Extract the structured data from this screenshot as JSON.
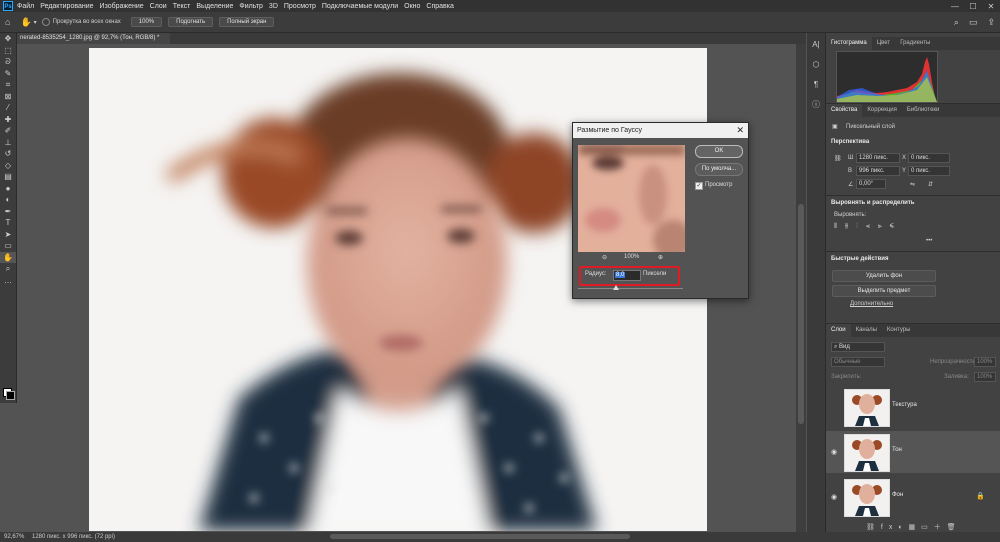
{
  "app": {
    "logo": "Ps"
  },
  "menu": [
    "Файл",
    "Редактирование",
    "Изображение",
    "Слои",
    "Текст",
    "Выделение",
    "Фильтр",
    "3D",
    "Просмотр",
    "Подключаемые модули",
    "Окно",
    "Справка"
  ],
  "options": {
    "scroll_all_label": "Прокрутка во всех окнах",
    "zoom_value": "100%",
    "fit_button": "Подогнать",
    "fullscreen_button": "Полный экран"
  },
  "document": {
    "tab_title": "nerated-8535254_1280.jpg @ 92,7% (Тон, RGB/8) *"
  },
  "status": {
    "zoom": "92,67%",
    "info": "1280 пикс. x 996 пикс. (72 ppi)"
  },
  "panels": {
    "top_tabs": [
      "Гистограмма",
      "Цвет",
      "Градиенты"
    ],
    "props_tabs": [
      "Свойства",
      "Коррекция",
      "Библиотеки"
    ],
    "pixel_layer": "Пиксельный слой",
    "perspective": "Перспектива",
    "w_label": "Ш",
    "w_value": "1280 пикс.",
    "h_label": "В",
    "h_value": "996 пикс.",
    "x_label": "X",
    "x_value": "0 пикс.",
    "y_label": "Y",
    "y_value": "0 пикс.",
    "angle_value": "0,00°",
    "align_section": "Выровнять и распределить",
    "align_label": "Выровнять:",
    "quick_section": "Быстрые действия",
    "remove_bg": "Удалить фон",
    "select_subject": "Выделить предмет",
    "more_link": "Дополнительно"
  },
  "layers_panel": {
    "tabs": [
      "Слои",
      "Каналы",
      "Контуры"
    ],
    "search": "Вид",
    "blend_mode": "Обычные",
    "opacity_label": "Непрозрачность:",
    "opacity_value": "100%",
    "lock_label": "Закрепить:",
    "fill_label": "Заливка:",
    "fill_value": "100%",
    "layers": [
      {
        "name": "Текстура",
        "visible": false,
        "selected": false
      },
      {
        "name": "Тон",
        "visible": true,
        "selected": true
      },
      {
        "name": "Фон",
        "visible": true,
        "selected": false
      }
    ]
  },
  "dialog": {
    "title": "Размытие по Гауссу",
    "ok": "OK",
    "defaults": "По умолча...",
    "preview_label": "Просмотр",
    "preview_checked": true,
    "zoom": "100%",
    "radius_label": "Радиус:",
    "radius_value": "8,0",
    "radius_unit": "Пиксели",
    "radius_slider_fraction": 0.36
  },
  "colors": {
    "highlight": "#e01b24",
    "selection": "#3a77d8"
  }
}
